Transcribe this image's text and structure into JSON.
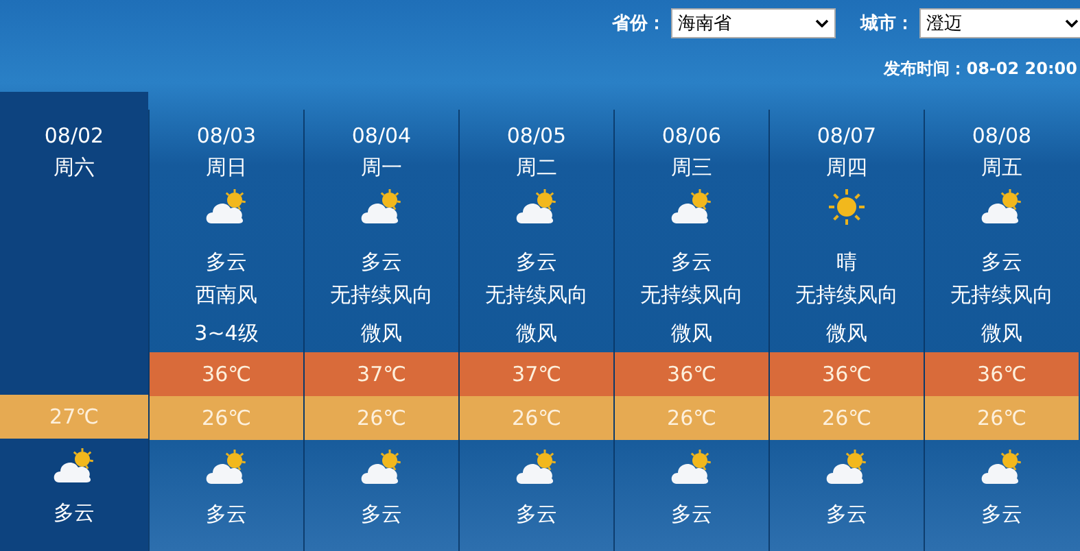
{
  "filters": {
    "province": {
      "label": "省份：",
      "value": "海南省"
    },
    "city": {
      "label": "城市：",
      "value": "澄迈"
    },
    "publish_time": "发布时间：08-02 20:00"
  },
  "days": [
    {
      "date": "08/02",
      "weekday": "周六",
      "selected": true,
      "low": "27℃",
      "night": {
        "kind": "partly_cloudy",
        "weather": "多云"
      }
    },
    {
      "date": "08/03",
      "weekday": "周日",
      "selected": false,
      "day": {
        "kind": "partly_cloudy",
        "weather": "多云",
        "wind": "西南风",
        "wind_level": "3~4级",
        "high": "36℃"
      },
      "low": "26℃",
      "night": {
        "kind": "partly_cloudy",
        "weather": "多云"
      }
    },
    {
      "date": "08/04",
      "weekday": "周一",
      "selected": false,
      "day": {
        "kind": "partly_cloudy",
        "weather": "多云",
        "wind": "无持续风向",
        "wind_level": "微风",
        "high": "37℃"
      },
      "low": "26℃",
      "night": {
        "kind": "partly_cloudy",
        "weather": "多云"
      }
    },
    {
      "date": "08/05",
      "weekday": "周二",
      "selected": false,
      "day": {
        "kind": "partly_cloudy",
        "weather": "多云",
        "wind": "无持续风向",
        "wind_level": "微风",
        "high": "37℃"
      },
      "low": "26℃",
      "night": {
        "kind": "partly_cloudy",
        "weather": "多云"
      }
    },
    {
      "date": "08/06",
      "weekday": "周三",
      "selected": false,
      "day": {
        "kind": "partly_cloudy",
        "weather": "多云",
        "wind": "无持续风向",
        "wind_level": "微风",
        "high": "36℃"
      },
      "low": "26℃",
      "night": {
        "kind": "partly_cloudy",
        "weather": "多云"
      }
    },
    {
      "date": "08/07",
      "weekday": "周四",
      "selected": false,
      "day": {
        "kind": "sunny",
        "weather": "晴",
        "wind": "无持续风向",
        "wind_level": "微风",
        "high": "36℃"
      },
      "low": "26℃",
      "night": {
        "kind": "partly_cloudy",
        "weather": "多云"
      }
    },
    {
      "date": "08/08",
      "weekday": "周五",
      "selected": false,
      "day": {
        "kind": "partly_cloudy",
        "weather": "多云",
        "wind": "无持续风向",
        "wind_level": "微风",
        "high": "36℃"
      },
      "low": "26℃",
      "night": {
        "kind": "partly_cloudy",
        "weather": "多云"
      }
    }
  ]
}
